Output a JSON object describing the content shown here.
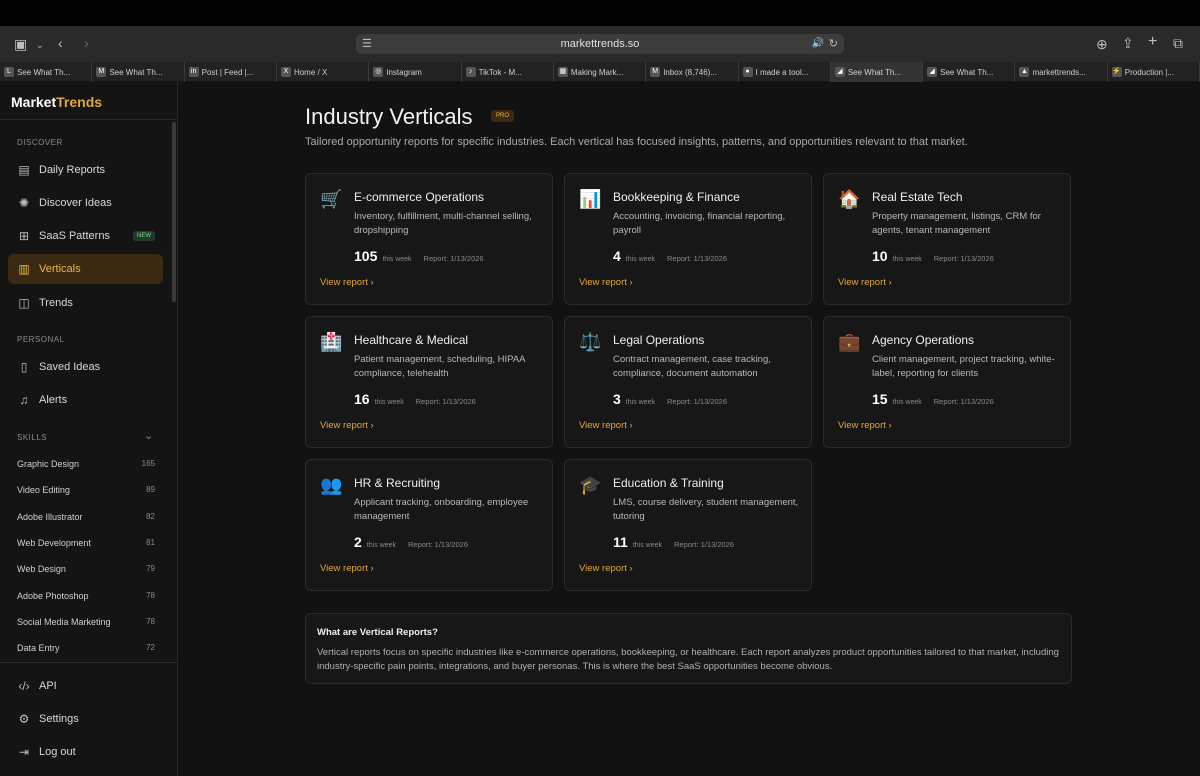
{
  "browser": {
    "url": "markettrends.so",
    "tabs": [
      {
        "label": "See What Th...",
        "fav": "L"
      },
      {
        "label": "See What Th...",
        "fav": "M"
      },
      {
        "label": "Post | Feed |...",
        "fav": "in"
      },
      {
        "label": "Home / X",
        "fav": "X"
      },
      {
        "label": "Instagram",
        "fav": "◎"
      },
      {
        "label": "TikTok - M...",
        "fav": "♪"
      },
      {
        "label": "Making Mark...",
        "fav": "▦"
      },
      {
        "label": "Inbox (8,746)...",
        "fav": "M"
      },
      {
        "label": "I made a tool...",
        "fav": "●"
      },
      {
        "label": "See What Th...",
        "fav": "◢"
      },
      {
        "label": "See What Th...",
        "fav": "◢"
      },
      {
        "label": "markettrends...",
        "fav": "▲"
      },
      {
        "label": "Production |...",
        "fav": "⚡"
      }
    ]
  },
  "sidebar": {
    "logo_a": "Market",
    "logo_b": "Trends",
    "discover_label": "DISCOVER",
    "personal_label": "PERSONAL",
    "skills_label": "SKILLS",
    "items": {
      "daily": "Daily Reports",
      "discover": "Discover Ideas",
      "saas": "SaaS Patterns",
      "saas_badge": "NEW",
      "verticals": "Verticals",
      "trends": "Trends",
      "saved": "Saved Ideas",
      "alerts": "Alerts",
      "api": "API",
      "settings": "Settings",
      "logout": "Log out"
    },
    "skills": [
      {
        "name": "Graphic Design",
        "count": "165"
      },
      {
        "name": "Video Editing",
        "count": "89"
      },
      {
        "name": "Adobe Illustrator",
        "count": "82"
      },
      {
        "name": "Web Development",
        "count": "81"
      },
      {
        "name": "Web Design",
        "count": "79"
      },
      {
        "name": "Adobe Photoshop",
        "count": "78"
      },
      {
        "name": "Social Media Marketing",
        "count": "78"
      },
      {
        "name": "Data Entry",
        "count": "72"
      }
    ]
  },
  "main": {
    "title": "Industry Verticals",
    "pro": "PRO",
    "subtitle": "Tailored opportunity reports for specific industries. Each vertical has focused insights, patterns, and opportunities relevant to that market.",
    "cards": [
      {
        "icon": "🛒",
        "title": "E-commerce Operations",
        "desc": "Inventory, fulfillment, multi-channel selling, dropshipping",
        "num": "105",
        "week": "this week",
        "report": "Report: 1/13/2026",
        "link": "View report"
      },
      {
        "icon": "📊",
        "title": "Bookkeeping & Finance",
        "desc": "Accounting, invoicing, financial reporting, payroll",
        "num": "4",
        "week": "this week",
        "report": "Report: 1/13/2026",
        "link": "View report"
      },
      {
        "icon": "🏠",
        "title": "Real Estate Tech",
        "desc": "Property management, listings, CRM for agents, tenant management",
        "num": "10",
        "week": "this week",
        "report": "Report: 1/13/2026",
        "link": "View report"
      },
      {
        "icon": "🏥",
        "title": "Healthcare & Medical",
        "desc": "Patient management, scheduling, HIPAA compliance, telehealth",
        "num": "16",
        "week": "this week",
        "report": "Report: 1/13/2026",
        "link": "View report"
      },
      {
        "icon": "⚖️",
        "title": "Legal Operations",
        "desc": "Contract management, case tracking, compliance, document automation",
        "num": "3",
        "week": "this week",
        "report": "Report: 1/13/2026",
        "link": "View report"
      },
      {
        "icon": "💼",
        "title": "Agency Operations",
        "desc": "Client management, project tracking, white-label, reporting for clients",
        "num": "15",
        "week": "this week",
        "report": "Report: 1/13/2026",
        "link": "View report"
      },
      {
        "icon": "👥",
        "title": "HR & Recruiting",
        "desc": "Applicant tracking, onboarding, employee management",
        "num": "2",
        "week": "this week",
        "report": "Report: 1/13/2026",
        "link": "View report"
      },
      {
        "icon": "🎓",
        "title": "Education & Training",
        "desc": "LMS, course delivery, student management, tutoring",
        "num": "11",
        "week": "this week",
        "report": "Report: 1/13/2026",
        "link": "View report"
      }
    ],
    "info_title": "What are Vertical Reports?",
    "info_text": "Vertical reports focus on specific industries like e-commerce operations, bookkeeping, or healthcare. Each report analyzes product opportunities tailored to that market, including industry-specific pain points, integrations, and buyer personas. This is where the best SaaS opportunities become obvious."
  }
}
